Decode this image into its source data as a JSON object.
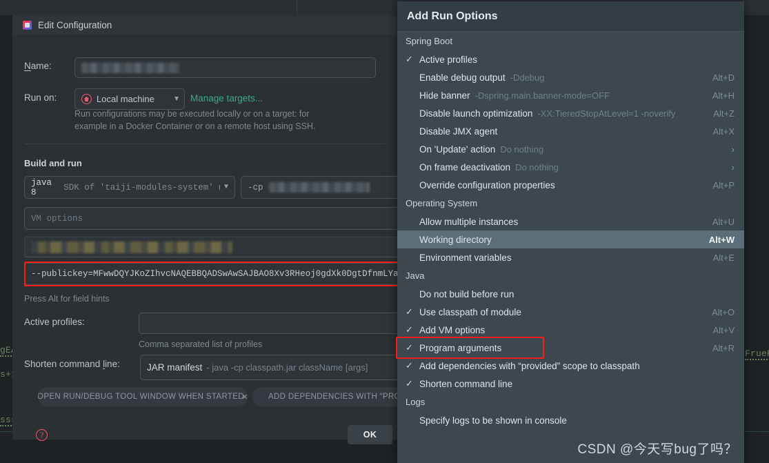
{
  "dialog": {
    "title": "Edit Configuration",
    "icon": "intellij-run-config-icon",
    "name_label": "Name:",
    "name_value": "",
    "run_on_label": "Run on:",
    "run_on_value": "Local machine",
    "run_on_icon": "home-icon",
    "manage_targets_link": "Manage targets...",
    "run_on_hint_line1": "Run configurations may be executed locally or on a target: for",
    "run_on_hint_line2": "example in a Docker Container or on a remote host using SSH.",
    "build_and_run_title": "Build and run",
    "sdk_value": "java 8",
    "sdk_suffix": "SDK of 'taiji-modules-system' mod",
    "cp_label": "-cp",
    "cp_value": "",
    "vm_options_placeholder": "VM options",
    "redacted_field_value": "",
    "program_arguments_value": "--publickey=MFwwDQYJKoZIhvcNAQEBBQADSwAwSAJBAO8Xv3RHeoj0gdXk0DgtDfnmLYaUOd+",
    "field_hints_text": "Press Alt for field hints",
    "active_profiles_label": "Active profiles:",
    "active_profiles_value": "",
    "active_profiles_hint": "Comma separated list of profiles",
    "shorten_cmd_label": "Shorten command line:",
    "shorten_cmd_value": "JAR manifest",
    "shorten_cmd_detail": "- java -cp classpath.jar className [args]",
    "pill_open_run_debug": "OPEN RUN/DEBUG TOOL WINDOW WHEN STARTED",
    "pill_open_run_debug_x": "✕",
    "pill_add_dependencies": "ADD DEPENDENCIES WITH “PROVIDED”",
    "help_glyph": "?",
    "ok_label": "OK"
  },
  "popup": {
    "title": "Add Run Options",
    "groups": [
      {
        "name": "Spring Boot",
        "items": [
          {
            "checked": true,
            "label": "Active profiles",
            "hint": "",
            "shortcut": "",
            "arrow": false
          },
          {
            "checked": false,
            "label": "Enable debug output",
            "hint": "-Ddebug",
            "shortcut": "Alt+D",
            "arrow": false
          },
          {
            "checked": false,
            "label": "Hide banner",
            "hint": "-Dspring.main.banner-mode=OFF",
            "shortcut": "Alt+H",
            "arrow": false
          },
          {
            "checked": false,
            "label": "Disable launch optimization",
            "hint": "-XX:TieredStopAtLevel=1 -noverify",
            "shortcut": "Alt+Z",
            "arrow": false
          },
          {
            "checked": false,
            "label": "Disable JMX agent",
            "hint": "",
            "shortcut": "Alt+X",
            "arrow": false
          },
          {
            "checked": false,
            "label": "On 'Update' action",
            "hint": "Do nothing",
            "shortcut": "",
            "arrow": true
          },
          {
            "checked": false,
            "label": "On frame deactivation",
            "hint": "Do nothing",
            "shortcut": "",
            "arrow": true
          },
          {
            "checked": false,
            "label": "Override configuration properties",
            "hint": "",
            "shortcut": "Alt+P",
            "arrow": false
          }
        ]
      },
      {
        "name": "Operating System",
        "items": [
          {
            "checked": false,
            "label": "Allow multiple instances",
            "hint": "",
            "shortcut": "Alt+U",
            "arrow": false
          },
          {
            "checked": false,
            "label": "Working directory",
            "hint": "",
            "shortcut": "Alt+W",
            "arrow": false,
            "selected": true
          },
          {
            "checked": false,
            "label": "Environment variables",
            "hint": "",
            "shortcut": "Alt+E",
            "arrow": false
          }
        ]
      },
      {
        "name": "Java",
        "items": [
          {
            "checked": false,
            "label": "Do not build before run",
            "hint": "",
            "shortcut": "",
            "arrow": false
          },
          {
            "checked": true,
            "label": "Use classpath of module",
            "hint": "",
            "shortcut": "Alt+O",
            "arrow": false
          },
          {
            "checked": true,
            "label": "Add VM options",
            "hint": "",
            "shortcut": "Alt+V",
            "arrow": false
          },
          {
            "checked": true,
            "label": "Program arguments",
            "hint": "",
            "shortcut": "Alt+R",
            "arrow": false,
            "highlighted": true
          },
          {
            "checked": true,
            "label": "Add dependencies with “provided” scope to classpath",
            "hint": "",
            "shortcut": "",
            "arrow": false
          },
          {
            "checked": true,
            "label": "Shorten command line",
            "hint": "",
            "shortcut": "",
            "arrow": false
          }
        ]
      },
      {
        "name": "Logs",
        "items": [
          {
            "checked": false,
            "label": "Specify logs to be shown in console",
            "hint": "",
            "shortcut": "",
            "arrow": false
          }
        ]
      }
    ],
    "check_glyph": "✓",
    "arrow_glyph": "›"
  },
  "background": {
    "code_fragments": [
      "gEA",
      "s+1",
      "sss",
      "FrueR"
    ]
  },
  "watermark": "CSDN @今天写bug了吗？",
  "colors": {
    "dialog_bg": "#2b3033",
    "popup_bg": "#3c474e",
    "popup_header_bg": "#333d44",
    "selected_row": "#5c6e79",
    "accent_link": "#3ea98a",
    "highlight_red": "#ff1a1a",
    "code_green": "#6a8759"
  }
}
